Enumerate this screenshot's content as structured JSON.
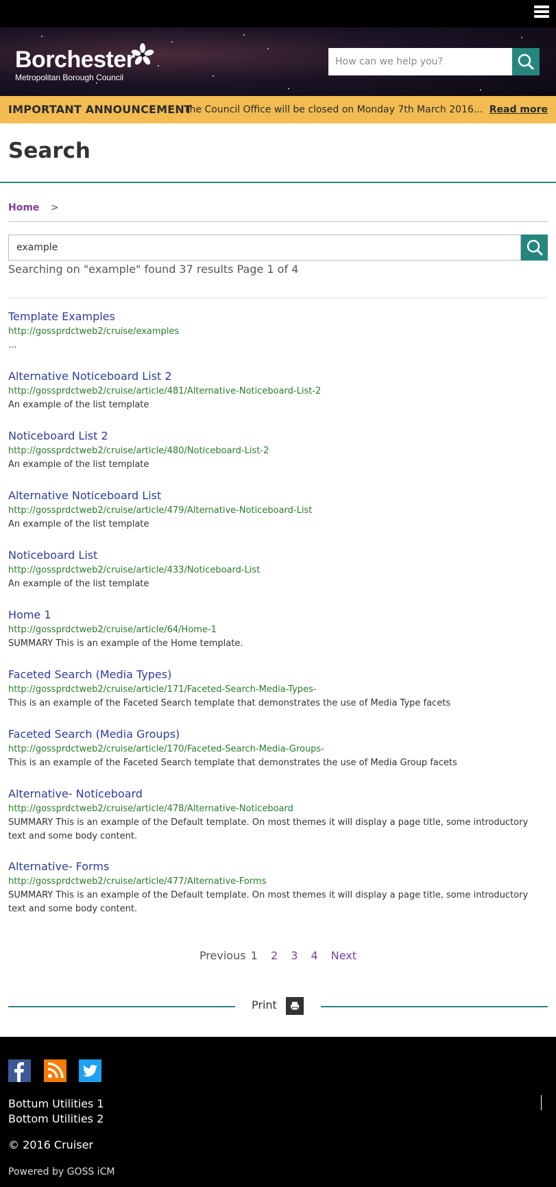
{
  "header": {
    "logo_name": "Borchester",
    "logo_sub": "Metropolitan Borough Council",
    "search_placeholder": "How can we help you?"
  },
  "announcement": {
    "label": "IMPORTANT ANNOUNCEMENT",
    "message": "The Council Office will be closed on Monday 7th March 2016...",
    "read_more": "Read more"
  },
  "page": {
    "title": "Search"
  },
  "breadcrumb": {
    "home": "Home",
    "separator": ">"
  },
  "search": {
    "value": "example",
    "summary": "Searching on \"example\" found 37 results Page 1 of 4"
  },
  "results": [
    {
      "title": "Template Examples",
      "url": "http://gossprdctweb2/cruise/examples",
      "desc": "..."
    },
    {
      "title": "Alternative Noticeboard List 2",
      "url": "http://gossprdctweb2/cruise/article/481/Alternative-Noticeboard-List-2",
      "desc": "An example of the list template"
    },
    {
      "title": "Noticeboard List 2",
      "url": "http://gossprdctweb2/cruise/article/480/Noticeboard-List-2",
      "desc": "An example of the list template"
    },
    {
      "title": "Alternative Noticeboard List",
      "url": "http://gossprdctweb2/cruise/article/479/Alternative-Noticeboard-List",
      "desc": "An example of the list template"
    },
    {
      "title": "Noticeboard List",
      "url": "http://gossprdctweb2/cruise/article/433/Noticeboard-List",
      "desc": "An example of the list template"
    },
    {
      "title": "Home 1",
      "url": "http://gossprdctweb2/cruise/article/64/Home-1",
      "desc": "SUMMARY This is an example of the Home template."
    },
    {
      "title": "Faceted Search (Media Types)",
      "url": "http://gossprdctweb2/cruise/article/171/Faceted-Search-Media-Types-",
      "desc": "This is an example of the Faceted Search template that demonstrates the use of Media Type facets"
    },
    {
      "title": "Faceted Search (Media Groups)",
      "url": "http://gossprdctweb2/cruise/article/170/Faceted-Search-Media-Groups-",
      "desc": "This is an example of the Faceted Search template that demonstrates the use of Media Group facets"
    },
    {
      "title": "Alternative- Noticeboard",
      "url": "http://gossprdctweb2/cruise/article/478/Alternative-Noticeboard",
      "desc": "SUMMARY This is an example of the Default template. On most themes it will display a page title, some introductory text and some body content."
    },
    {
      "title": "Alternative- Forms",
      "url": "http://gossprdctweb2/cruise/article/477/Alternative-Forms",
      "desc": "SUMMARY This is an example of the Default template. On most themes it will display a page title, some introductory text and some body content."
    }
  ],
  "pagination": {
    "previous": "Previous",
    "current": "1",
    "pages": [
      "2",
      "3",
      "4"
    ],
    "next": "Next"
  },
  "print": {
    "label": "Print"
  },
  "footer": {
    "utilities_1": "Bottum Utilities 1",
    "utilities_2": "Bottom Utilities 2",
    "copyright": "© 2016 Cruiser",
    "powered": "Powered by GOSS iCM"
  },
  "colors": {
    "accent": "#25867e",
    "announcement": "#f2bc52",
    "link_title": "#2e3d9a",
    "link_url": "#2b7a2b",
    "breadcrumb": "#7b3f97"
  }
}
